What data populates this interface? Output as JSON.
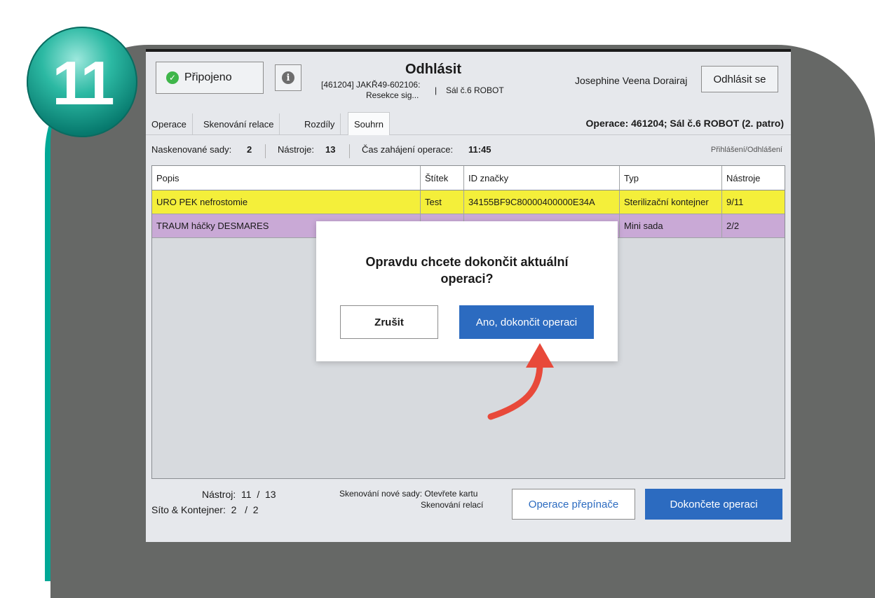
{
  "badge": {
    "number": "11"
  },
  "header": {
    "connection_label": "Připojeno",
    "title": "Odhlásit",
    "op_line1": "[461204] JAKŘ49-602106:",
    "op_line2": "Resekce sig...",
    "separator": "|",
    "room": "Sál č.6 ROBOT",
    "user": "Josephine Veena Dorairaj",
    "logout_label": "Odhlásit se"
  },
  "tabs": [
    {
      "label": "Operace"
    },
    {
      "label": "Skenování relace"
    },
    {
      "label": "Rozdíly"
    },
    {
      "label": "Souhrn"
    }
  ],
  "operation_header": "Operace: 461204; Sál č.6 ROBOT (2. patro)",
  "stats": {
    "sets_label": "Naskenované sady:",
    "sets_value": "2",
    "tools_label": "Nástroje:",
    "tools_value": "13",
    "start_label": "Čas zahájení operace:",
    "start_value": "11:45",
    "login_link": "Přihlášení/Odhlášení"
  },
  "table": {
    "columns": [
      "Popis",
      "Štítek",
      "ID značky",
      "Typ",
      "Nástroje"
    ],
    "rows": [
      {
        "popis": "URO PEK nefrostomie",
        "stitek": "Test",
        "id": "34155BF9C80000400000E34A",
        "typ": "Sterilizační kontejner",
        "nastroje": "9/11",
        "color": "#f4ef3a"
      },
      {
        "popis": "TRAUM háčky DESMARES",
        "stitek": "",
        "id": "",
        "typ": "Mini sada",
        "nastroje": "2/2",
        "color": "#c9a9d6"
      }
    ]
  },
  "dialog": {
    "question_line1": "Opravdu chcete dokončit aktuální",
    "question_line2": "operaci?",
    "cancel_label": "Zrušit",
    "confirm_label": "Ano, dokončit operaci"
  },
  "footer": {
    "tool_count": "Nástroj:  11  /  13",
    "set_count": "Síto & Kontejner:  2   /  2",
    "hint_line1": "Skenování nové sady: Otevřete kartu",
    "hint_line2": "Skenování relací",
    "switch_label": "Operace přepínače",
    "finish_label": "Dokončete operaci"
  },
  "colors": {
    "accent": "#2c6bc0",
    "arrow": "#e8493a",
    "frame": "#00a896"
  }
}
